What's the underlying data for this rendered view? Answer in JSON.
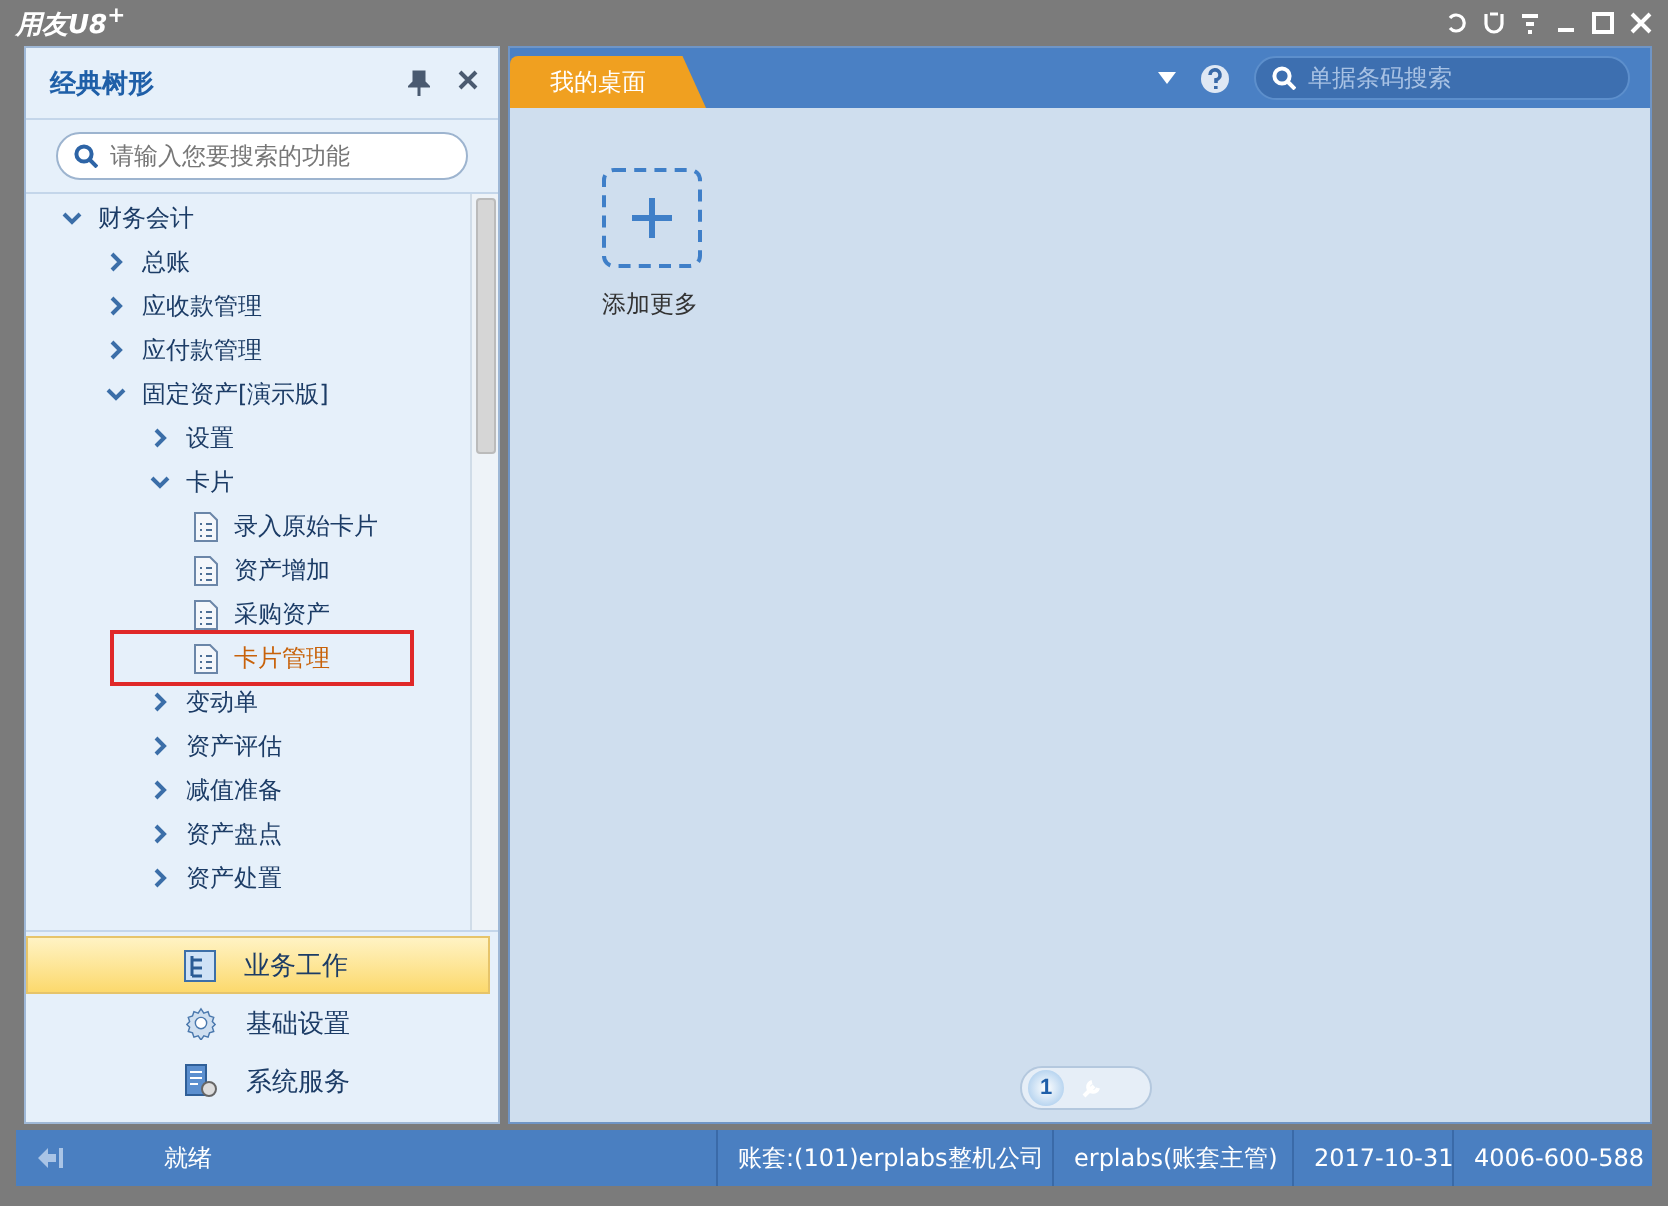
{
  "window": {
    "title": "用友U8$^{+}$"
  },
  "sidebar": {
    "title": "经典树形",
    "search": {
      "placeholder": "请输入您要搜索的功能"
    },
    "tree": [
      {
        "label": "财务会计",
        "expanded": true,
        "selected": false,
        "children": [
          {
            "label": "总账",
            "expanded": false,
            "selected": false
          },
          {
            "label": "应收款管理",
            "expanded": false,
            "selected": false
          },
          {
            "label": "应付款管理",
            "expanded": false,
            "selected": false
          },
          {
            "label": "固定资产[演示版]",
            "expanded": true,
            "selected": false,
            "children": [
              {
                "label": "设置",
                "expanded": false,
                "selected": false
              },
              {
                "label": "卡片",
                "expanded": true,
                "selected": false,
                "children": [
                  {
                    "label": "录入原始卡片",
                    "kind": "leaf",
                    "selected": false,
                    "annotated": false
                  },
                  {
                    "label": "资产增加",
                    "kind": "leaf",
                    "selected": false,
                    "annotated": false
                  },
                  {
                    "label": "采购资产",
                    "kind": "leaf",
                    "selected": false,
                    "annotated": false
                  },
                  {
                    "label": "卡片管理",
                    "kind": "leaf",
                    "selected": true,
                    "annotated": true
                  }
                ]
              },
              {
                "label": "变动单",
                "expanded": false,
                "selected": false
              },
              {
                "label": "资产评估",
                "expanded": false,
                "selected": false
              },
              {
                "label": "减值准备",
                "expanded": false,
                "selected": false
              },
              {
                "label": "资产盘点",
                "expanded": false,
                "selected": false
              },
              {
                "label": "资产处置",
                "expanded": false,
                "selected": false
              }
            ]
          }
        ]
      }
    ],
    "nav": [
      {
        "label": "业务工作",
        "kind": "business",
        "selected": true
      },
      {
        "label": "基础设置",
        "kind": "settings",
        "selected": false
      },
      {
        "label": "系统服务",
        "kind": "service",
        "selected": false
      }
    ]
  },
  "tabs": [
    {
      "label": "我的桌面",
      "selected": true
    }
  ],
  "top_search": {
    "placeholder": "单据条码搜索"
  },
  "desktop": {
    "add_label": "添加更多",
    "page": "1"
  },
  "status_bar": {
    "status": "就绪",
    "account": "账套:(101)erplabs整机公司",
    "user": "erplabs(账套主管)",
    "date": "2017-10-31",
    "phone": "4006-600-588"
  }
}
